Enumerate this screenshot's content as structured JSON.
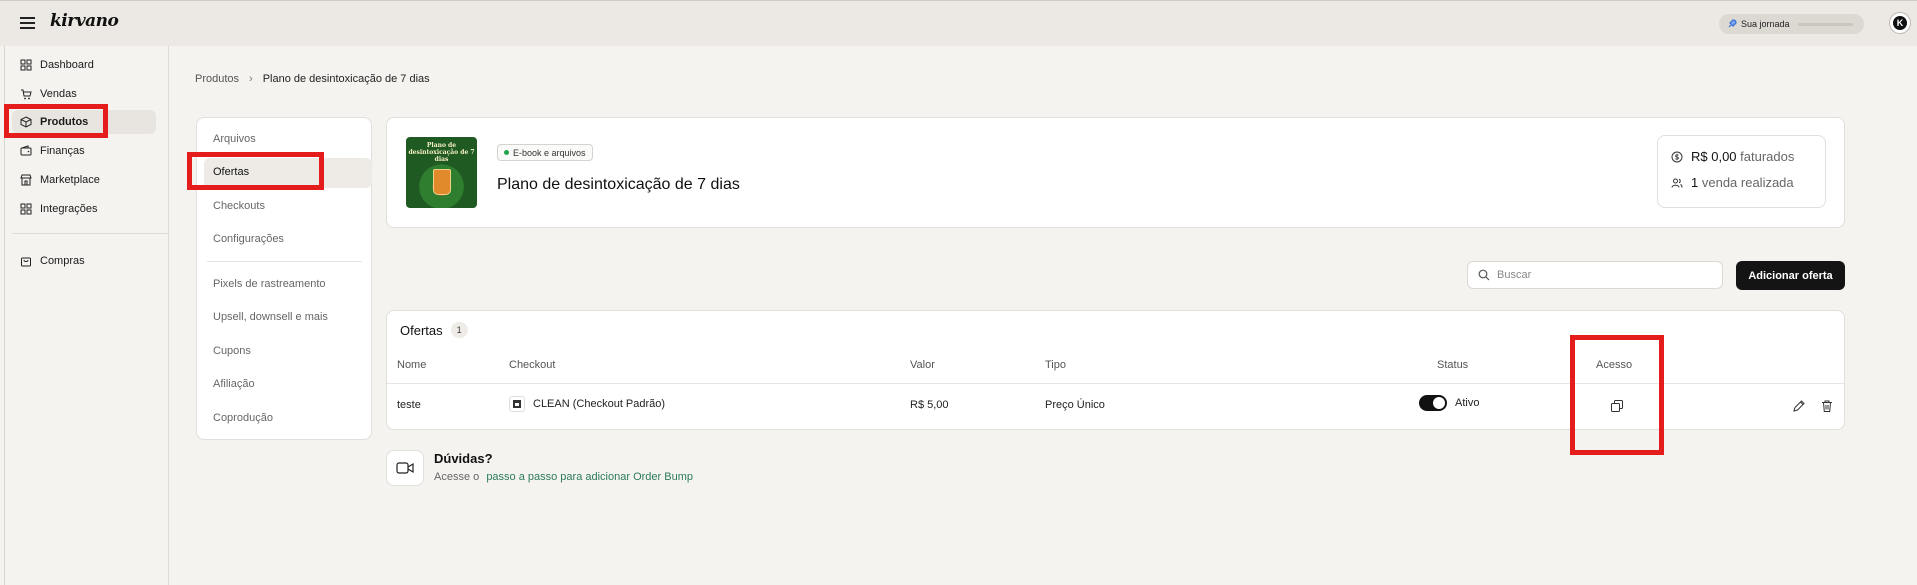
{
  "topbar": {
    "logo": "kirvano",
    "jornada_label": "Sua jornada",
    "avatar_letter": "K"
  },
  "sidebar": {
    "items": [
      {
        "label": "Dashboard",
        "icon": "grid-icon"
      },
      {
        "label": "Vendas",
        "icon": "cart-icon"
      },
      {
        "label": "Produtos",
        "icon": "box-icon",
        "active": true
      },
      {
        "label": "Finanças",
        "icon": "wallet-icon"
      },
      {
        "label": "Marketplace",
        "icon": "store-icon"
      },
      {
        "label": "Integrações",
        "icon": "grid-icon"
      }
    ],
    "secondary": [
      {
        "label": "Compras",
        "icon": "bag-icon"
      }
    ]
  },
  "breadcrumb": {
    "parent": "Produtos",
    "separator": "›",
    "current": "Plano de desintoxicação de 7 dias"
  },
  "submenu": {
    "items": [
      "Arquivos",
      "Ofertas",
      "Checkouts",
      "Configurações"
    ],
    "active": "Ofertas",
    "extra_items": [
      "Pixels de rastreamento",
      "Upsell, downsell e mais",
      "Cupons",
      "Afiliação",
      "Coprodução"
    ]
  },
  "product": {
    "image_text": "Plano de desintoxicação de 7 dias",
    "badge": "E-book e arquivos",
    "title": "Plano de desintoxicação de 7 dias",
    "revenue_value": "R$ 0,00",
    "revenue_suffix": "faturados",
    "sales_value": "1",
    "sales_suffix": "venda realizada"
  },
  "toolbar": {
    "search_placeholder": "Buscar",
    "add_label": "Adicionar oferta"
  },
  "offers": {
    "title": "Ofertas",
    "count": "1",
    "columns": [
      "Nome",
      "Checkout",
      "Valor",
      "Tipo",
      "Status",
      "Acesso"
    ],
    "rows": [
      {
        "nome": "teste",
        "checkout": "CLEAN (Checkout Padrão)",
        "valor": "R$ 5,00",
        "tipo": "Preço Único",
        "status": "Ativo"
      }
    ]
  },
  "help": {
    "title": "Dúvidas?",
    "prefix": "Acesse o",
    "link": "passo a passo para adicionar Order Bump"
  },
  "colors": {
    "highlight": "#e41c1c",
    "primary_button": "#141414",
    "link": "#2b7a5c",
    "status_dot": "#22a34a"
  }
}
